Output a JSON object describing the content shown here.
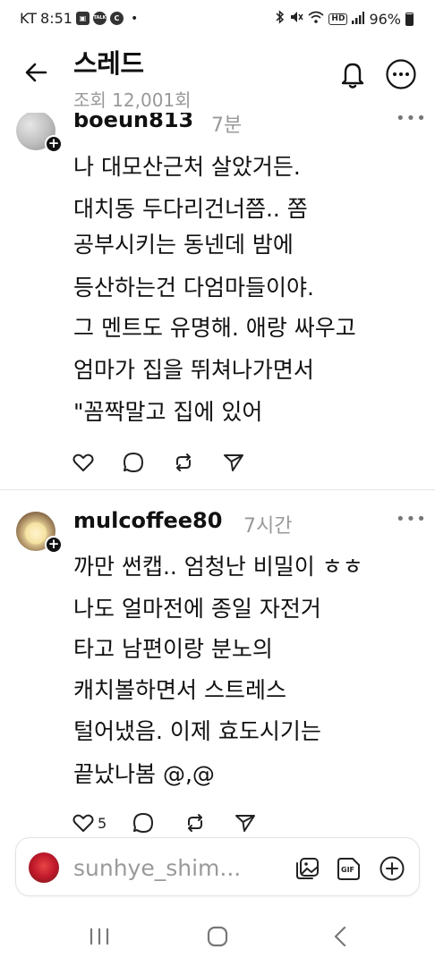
{
  "status_bar": {
    "carrier": "KT",
    "time": "8:51",
    "battery": "96%",
    "icons": [
      "gallery-icon",
      "talk-icon",
      "c-icon",
      "bluetooth-icon",
      "mute-icon",
      "wifi-icon",
      "hd-icon",
      "signal-icon",
      "battery-icon"
    ],
    "talk_label": "TALK",
    "c_label": "C",
    "hd_label": "HD"
  },
  "header": {
    "title": "스레드",
    "views": "조회 12,001회"
  },
  "comments": [
    {
      "username": "boeun813",
      "time": "7분",
      "lines": [
        "나 대모산근처 살았거든.",
        "대치동 두다리건너쯤.. 쫌",
        "공부시키는 동넨데 밤에",
        "등산하는건 다엄마들이야.",
        "그 멘트도 유명해. 애랑 싸우고",
        "엄마가 집을 뛰쳐나가면서",
        "\"꼼짝말고 집에 있어"
      ],
      "like_count": ""
    },
    {
      "username": "mulcoffee80",
      "time": "7시간",
      "lines": [
        "까만 썬캡.. 엄청난 비밀이 ㅎㅎ",
        "나도 얼마전에 종일 자전거",
        "타고 남편이랑 분노의",
        "캐치볼하면서 스트레스",
        "털어냈음. 이제 효도시기는",
        "끝났나봄 @,@"
      ],
      "like_count": "5"
    }
  ],
  "more_label": "•••",
  "plus_label": "+",
  "composer": {
    "placeholder": "sunhye_shim..."
  },
  "colors": {
    "text": "#111111",
    "muted": "#999999",
    "divider": "#e8e8e8"
  }
}
